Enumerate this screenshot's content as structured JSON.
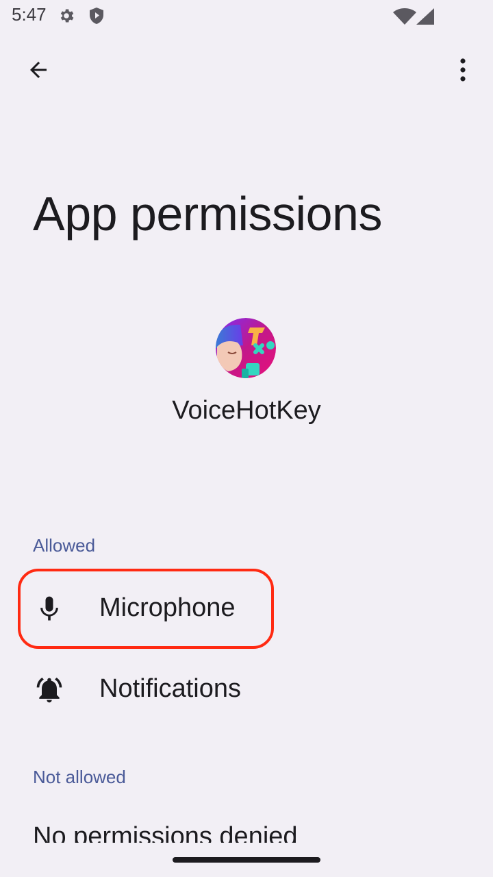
{
  "status_bar": {
    "time": "5:47",
    "icons": [
      "gear-icon",
      "shield-icon",
      "wifi-icon",
      "signal-icon"
    ]
  },
  "app_bar": {
    "back_icon": "arrow-back-icon",
    "menu_icon": "more-vert-icon"
  },
  "page": {
    "title": "App permissions"
  },
  "app": {
    "name": "VoiceHotKey",
    "icon": "voicehotkey-app-icon"
  },
  "sections": {
    "allowed": {
      "header": "Allowed",
      "items": [
        {
          "label": "Microphone",
          "icon": "microphone-icon"
        },
        {
          "label": "Notifications",
          "icon": "bell-icon"
        }
      ]
    },
    "not_allowed": {
      "header": "Not allowed",
      "empty_text": "No permissions denied"
    }
  },
  "colors": {
    "background": "#f2eff5",
    "section_header": "#4a5a98",
    "highlight": "#ff2a12"
  }
}
